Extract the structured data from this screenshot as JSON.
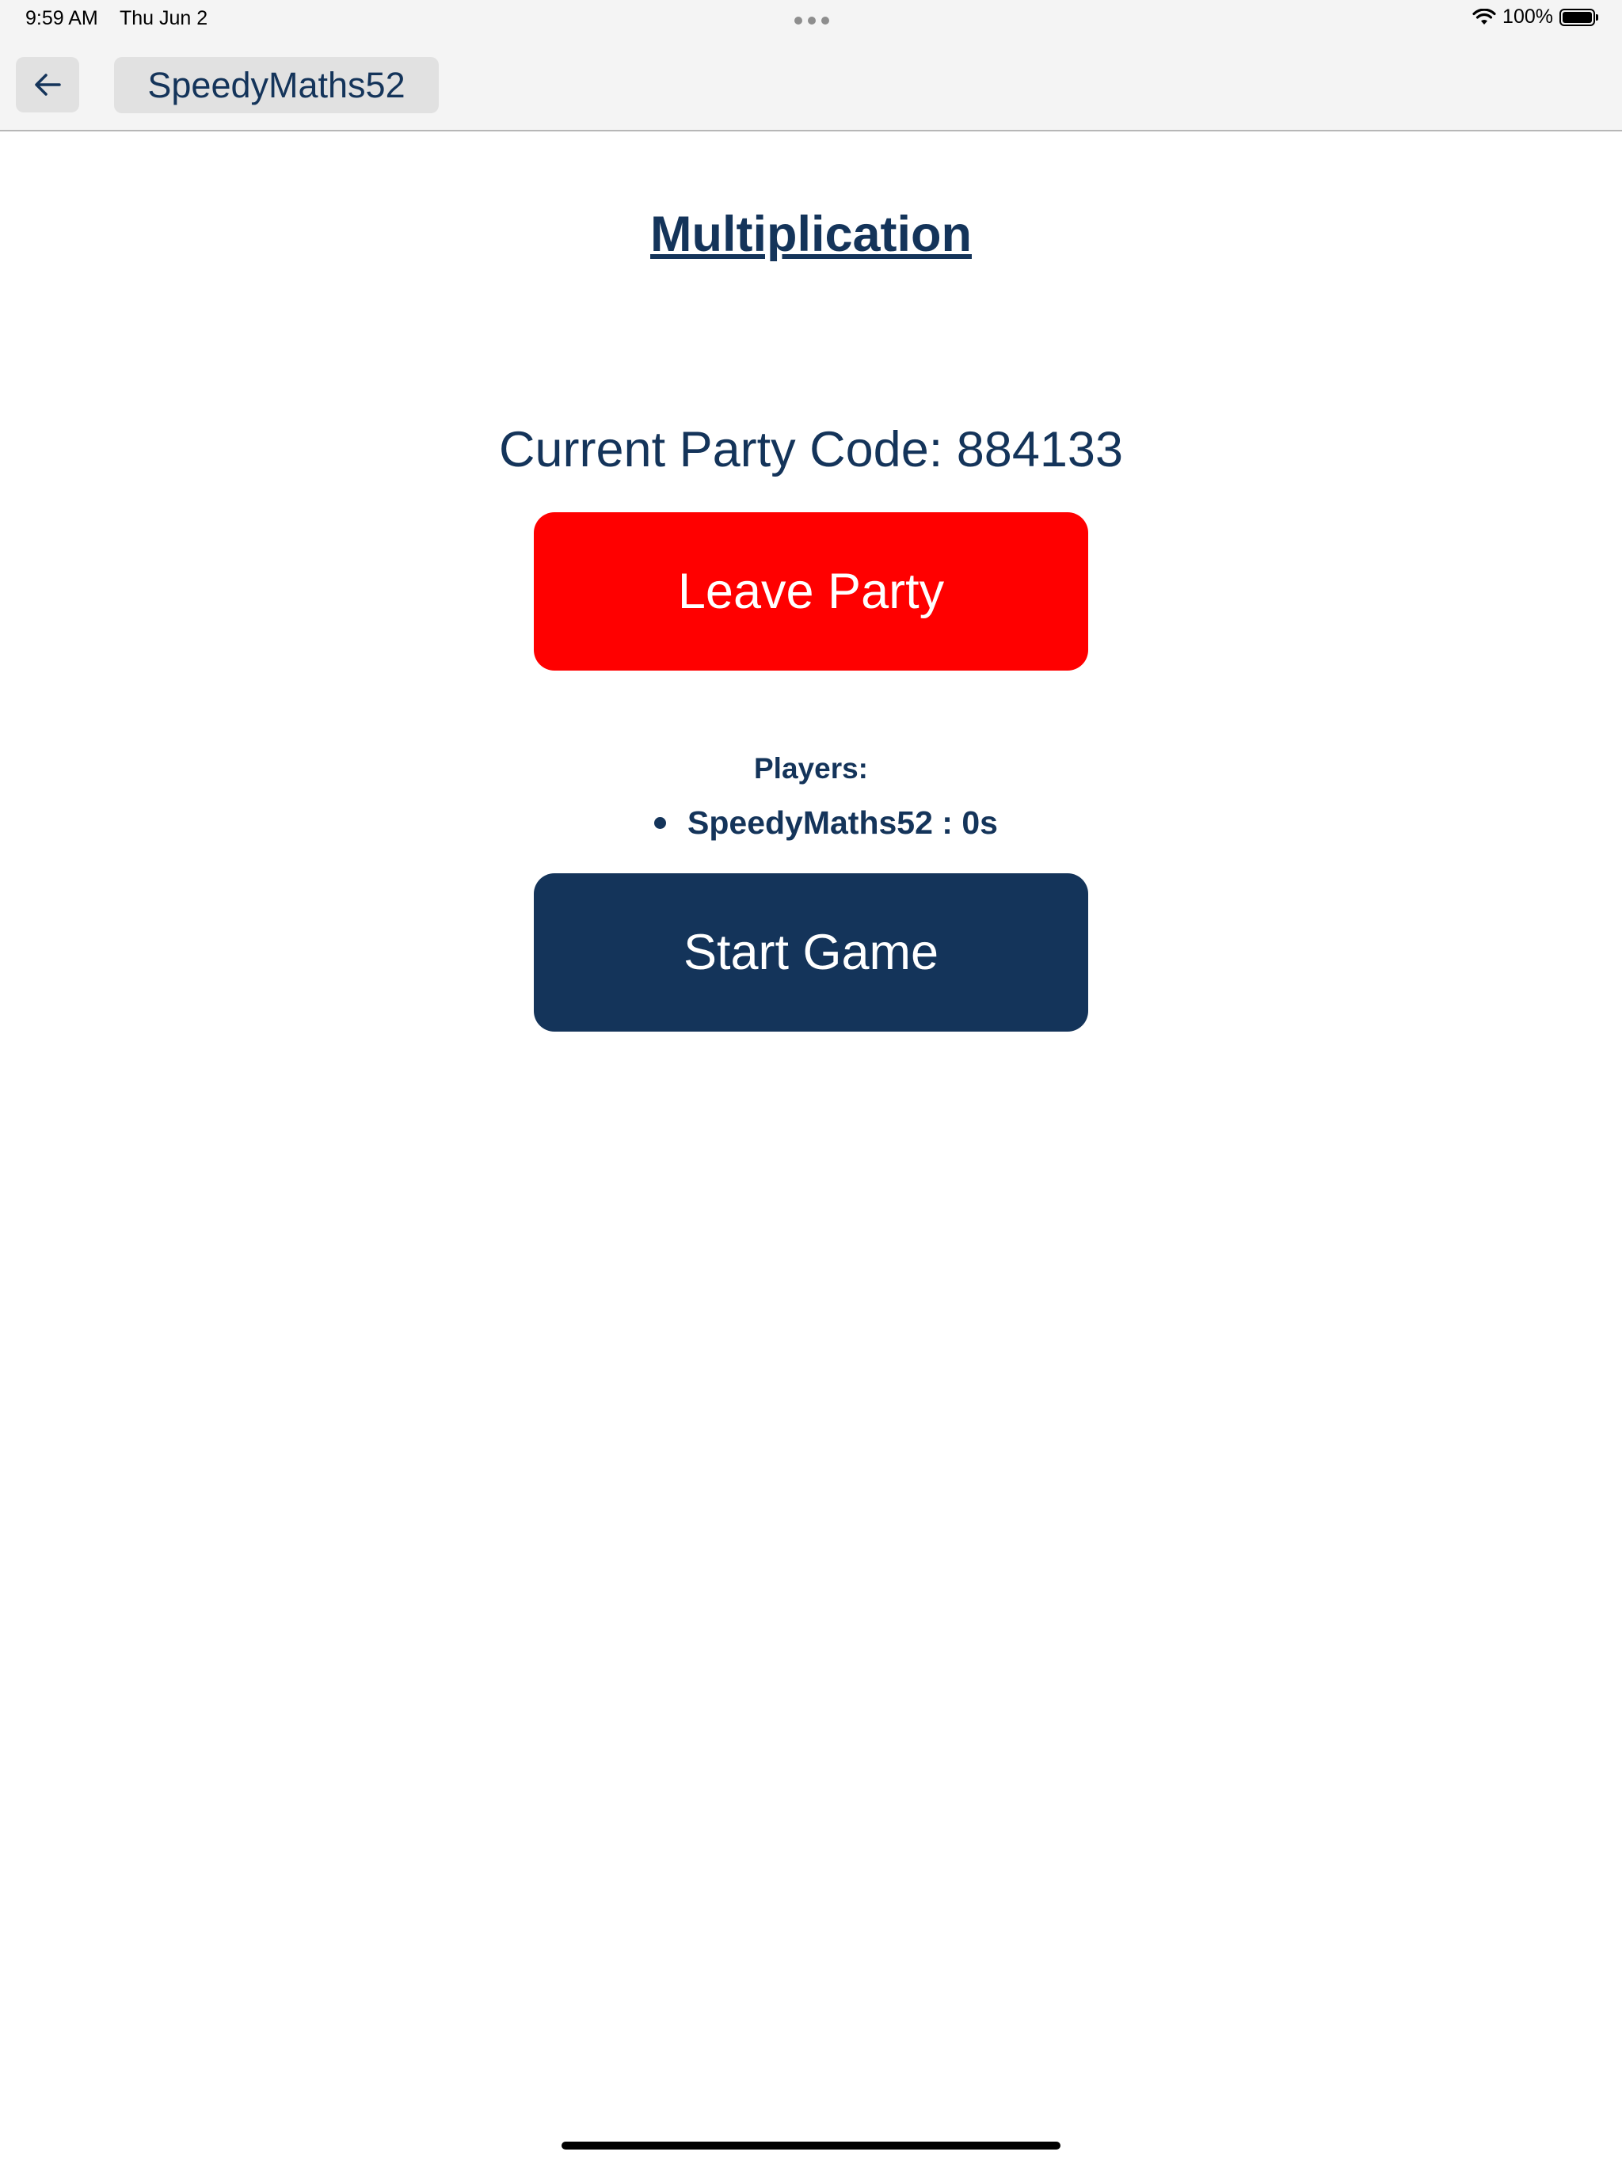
{
  "status_bar": {
    "time": "9:59 AM",
    "date": "Thu Jun 2",
    "battery": "100%",
    "icons": [
      "multitasking-dots-icon",
      "wifi-icon",
      "battery-icon"
    ]
  },
  "nav": {
    "back_icon": "arrow-left-icon",
    "username": "SpeedyMaths52"
  },
  "main": {
    "title": "Multiplication",
    "party_code_text": "Current Party Code: 884133",
    "leave_label": "Leave Party",
    "players_label": "Players:",
    "players": [
      {
        "entry": "SpeedyMaths52 : 0s"
      }
    ],
    "start_label": "Start Game"
  },
  "colors": {
    "primary": "#14345a",
    "danger": "#ff0000",
    "nav_background": "#f4f4f4",
    "chip_background": "#e1e1e1"
  }
}
